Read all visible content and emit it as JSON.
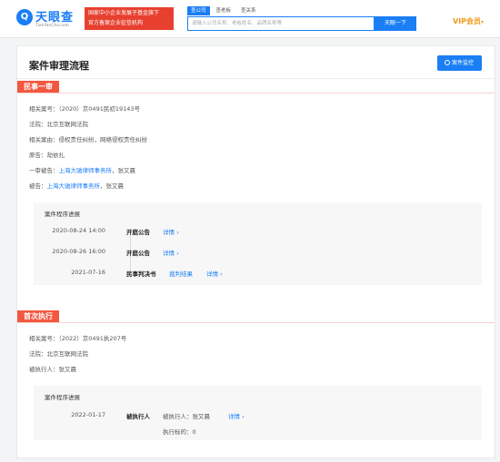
{
  "header": {
    "logo_mark": "Q",
    "logo_name": "天眼查",
    "logo_domain": "TianYanCha.com",
    "banner_line1": "国家中小企业发展子基金旗下",
    "banner_line2": "官方备案企业征信机构",
    "search_tabs": [
      "查公司",
      "查老板",
      "查关系"
    ],
    "search_placeholder": "请输入公司名称、老板姓名、品牌名称等",
    "search_button": "天眼一下",
    "vip_label": "VIP会员",
    "vip_caret": "▾"
  },
  "card": {
    "title": "案件审理流程",
    "monitor_button": "案件监控"
  },
  "case1": {
    "tag": "民事一审",
    "case_no": "相关案号：（2020）京0491民初19143号",
    "court": "法院：北京互联网法院",
    "cause": "相关案由：侵权责任纠纷，网络侵权责任纠纷",
    "plaintiff": "原告：劫依扎",
    "defendant1_prefix": "一审被告：",
    "defendant1_link": "上海大驰律师事务所",
    "defendant1_suffix": "，张又晨",
    "defendant2_prefix": "被告：",
    "defendant2_link": "上海大驰律师事务所",
    "defendant2_suffix": "，张又晨",
    "progress_title": "案件程序进展",
    "events": [
      {
        "date": "2020-08-24 14:00",
        "kind": "开庭公告",
        "detail": "详情 ›"
      },
      {
        "date": "2020-08-26 16:00",
        "kind": "开庭公告",
        "detail": "详情 ›"
      },
      {
        "date": "2021-07-16",
        "kind": "民事判决书",
        "extra": "裁判结果",
        "detail": "详情 ›"
      }
    ]
  },
  "case2": {
    "tag": "首次执行",
    "case_no": "相关案号：（2022）京0491执207号",
    "court": "法院：北京互联网法院",
    "executee": "被执行人：张又晨",
    "progress_title": "案件程序进展",
    "event": {
      "date": "2022-01-17",
      "kind": "被执行人",
      "sub": "被执行人：张又晨",
      "detail": "详情 ›",
      "amount": "执行标的：0"
    }
  }
}
